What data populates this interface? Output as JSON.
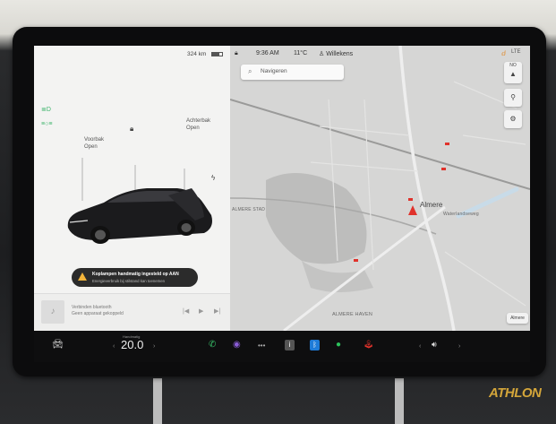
{
  "status": {
    "range": "324 km",
    "time": "9:36 AM",
    "temperature": "11°C",
    "user": "Willekens"
  },
  "vehicle": {
    "front_trunk_label": "Voorbak",
    "front_trunk_state": "Open",
    "rear_trunk_label": "Achterbak",
    "rear_trunk_state": "Open"
  },
  "alert": {
    "title": "Koplampen handmatig ingesteld op AAN",
    "subtitle": "Energieverbruik bij stilstand kan toenemen"
  },
  "media": {
    "source_title": "Verbinden bluetooth",
    "source_hint": "Geen apparaat gekoppeld"
  },
  "map": {
    "search_placeholder": "Navigeren",
    "compass_label": "NO",
    "city_label": "Almere",
    "district_1": "ALMERE STAD",
    "district_2": "ALMERE HAVEN",
    "station_label": "Waterlandseweg",
    "map_attribution": "Almere"
  },
  "dock": {
    "temperature_caption": "Handmatig",
    "temperature_value": "20.0"
  },
  "branding": {
    "watermark": "ATHLON"
  },
  "colors": {
    "accent_red": "#e0322b",
    "indicator_green": "#3bb36a",
    "warning_amber": "#f2b43a",
    "watermark_gold": "#d4a63a"
  }
}
